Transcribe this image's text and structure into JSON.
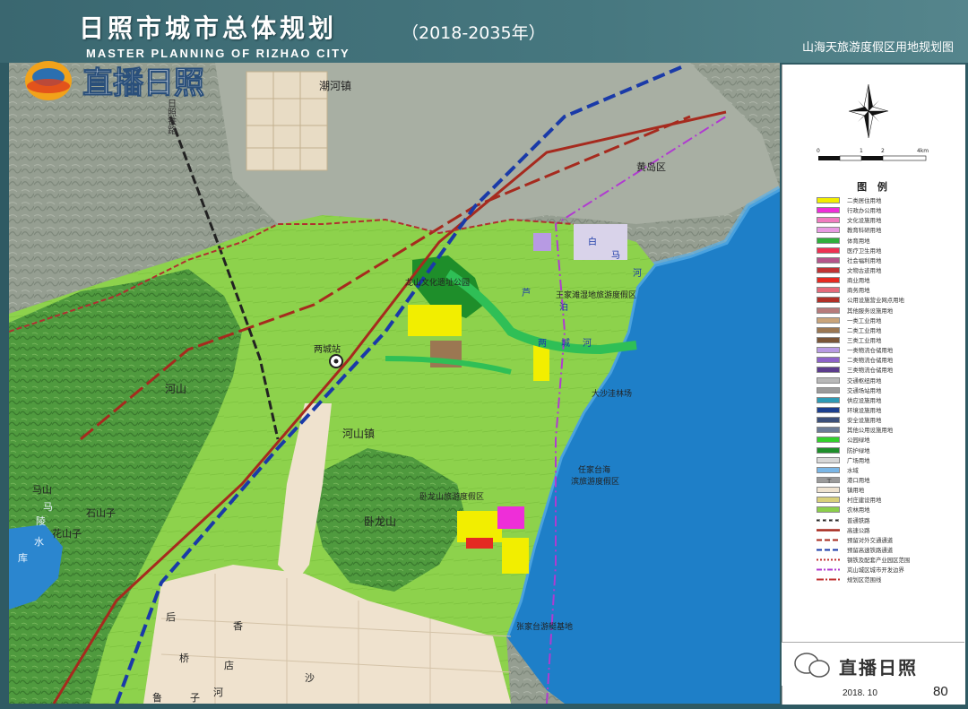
{
  "header": {
    "title": "日照市城市总体规划",
    "years": "（2018-2035年）",
    "subtitle_en": "MASTER PLANNING OF RIZHAO CITY",
    "map_name": "山海天旅游度假区用地规划图"
  },
  "watermark": {
    "top_text": "直播日照",
    "bottom_text": "直播日照"
  },
  "map": {
    "place_labels": {
      "chaohe": "潮河镇",
      "huangdao": "黄岛区",
      "longshan_park": "龙山文化遗址公园",
      "wangjiatan": "王家滩湿地旅游度假区",
      "dashawa": "大沙洼林场",
      "station": "两城站",
      "heshan_town": "河山镇",
      "heshan_mtn": "河山",
      "renjiatai": "任家台海",
      "renjiatai2": "滨旅游度假区",
      "wolong_resort": "卧龙山旅游度假区",
      "wolong": "卧龙山",
      "zhangjiatai": "张家台游艇基地",
      "mama": "马",
      "mashan": "马山",
      "huashanzi": "花山子",
      "shanzi": "石山子",
      "shuiku": "库",
      "shui": "水",
      "ling": "陵",
      "rizhao_rail": "日照铁路",
      "river_bai": "白",
      "river_ma": "马",
      "river_he": "河",
      "river_lu": "芦",
      "river_bo": "泊",
      "river_liang": "两",
      "river_cheng": "城",
      "river_he2": "河",
      "town_hou": "后",
      "town_xiang": "香",
      "town_dian": "店",
      "town_sha": "沙",
      "town_lu": "鲁",
      "town_zi": "子",
      "town_he3": "河",
      "town_qiao": "桥"
    },
    "colors": {
      "sea": "#1f7fc7",
      "green": "#8bcf4b",
      "forest": "#5aa64a",
      "relief": "#8f9a8c",
      "urban": "#efe3d0",
      "rail_red": "#a62a1e",
      "rail_blue": "#1a3aa8",
      "rail_purple": "#b03bd0"
    }
  },
  "scale_bar": {
    "ticks": [
      "0",
      "1",
      "2",
      "4km"
    ]
  },
  "legend": {
    "title": "图 例",
    "items": [
      {
        "label": "二类居住用地",
        "color": "#f2ee00",
        "kind": "fill"
      },
      {
        "label": "行政办公用地",
        "color": "#ee2ed8",
        "kind": "fill"
      },
      {
        "label": "文化设施用地",
        "color": "#f07bbf",
        "kind": "fill"
      },
      {
        "label": "教育科研用地",
        "color": "#e89ae2",
        "kind": "fill"
      },
      {
        "label": "体育用地",
        "color": "#2faf3b",
        "kind": "fill"
      },
      {
        "label": "医疗卫生用地",
        "color": "#ee3152",
        "kind": "fill"
      },
      {
        "label": "社会福利用地",
        "color": "#b5558a",
        "kind": "fill"
      },
      {
        "label": "文物古迹用地",
        "color": "#c03334",
        "kind": "fill"
      },
      {
        "label": "商业用地",
        "color": "#e52a22",
        "kind": "fill"
      },
      {
        "label": "商务用地",
        "color": "#e46a7a",
        "kind": "fill"
      },
      {
        "label": "公用设施营业网点用地",
        "color": "#b03028",
        "kind": "fill"
      },
      {
        "label": "其他服务设施用地",
        "color": "#b77b7b",
        "kind": "fill"
      },
      {
        "label": "一类工业用地",
        "color": "#c9a47a",
        "kind": "fill"
      },
      {
        "label": "二类工业用地",
        "color": "#9b7752",
        "kind": "fill"
      },
      {
        "label": "三类工业用地",
        "color": "#7a5537",
        "kind": "fill"
      },
      {
        "label": "一类物流仓储用地",
        "color": "#b79ae3",
        "kind": "fill"
      },
      {
        "label": "二类物流仓储用地",
        "color": "#8c62c8",
        "kind": "fill"
      },
      {
        "label": "三类物流仓储用地",
        "color": "#5b3c8c",
        "kind": "fill"
      },
      {
        "label": "交通枢纽用地",
        "color": "#b8b8b8",
        "kind": "fill"
      },
      {
        "label": "交通场站用地",
        "color": "#9a9a9a",
        "kind": "fill"
      },
      {
        "label": "供应设施用地",
        "color": "#2d9ab5",
        "kind": "fill"
      },
      {
        "label": "环境设施用地",
        "color": "#1b3f8f",
        "kind": "fill"
      },
      {
        "label": "安全设施用地",
        "color": "#3b4f7a",
        "kind": "fill"
      },
      {
        "label": "其他公用设施用地",
        "color": "#6b7b96",
        "kind": "fill"
      },
      {
        "label": "公园绿地",
        "color": "#33d02c",
        "kind": "fill"
      },
      {
        "label": "防护绿地",
        "color": "#1e8e2a",
        "kind": "fill"
      },
      {
        "label": "广场用地",
        "color": "#d8d8d8",
        "kind": "fill"
      },
      {
        "label": "水域",
        "color": "#7ab6e6",
        "kind": "fill"
      },
      {
        "label": "港口用地",
        "color": "#9a9a9a",
        "kind": "port"
      },
      {
        "label": "镇用地",
        "color": "#efe3d0",
        "kind": "fill"
      },
      {
        "label": "村庄建设用地",
        "color": "#d8d07a",
        "kind": "fill"
      },
      {
        "label": "农林用地",
        "color": "#8bcf4b",
        "kind": "fill"
      },
      {
        "label": "普通铁路",
        "color": "#222222",
        "kind": "rail"
      },
      {
        "label": "高速公路",
        "color": "#a62a1e",
        "kind": "line"
      },
      {
        "label": "预留对外交通通道",
        "color": "#a62a1e",
        "kind": "dash"
      },
      {
        "label": "预留高速铁路通道",
        "color": "#1a3aa8",
        "kind": "dash"
      },
      {
        "label": "钢铁及配套产业园区范围",
        "color": "#c03030",
        "kind": "dot"
      },
      {
        "label": "岚山城区城市开发边界",
        "color": "#b03bd0",
        "kind": "dashdot"
      },
      {
        "label": "规划区范围线",
        "color": "#c03030",
        "kind": "dashdot2"
      }
    ]
  },
  "footer": {
    "date": "2018. 10",
    "page": "80"
  }
}
